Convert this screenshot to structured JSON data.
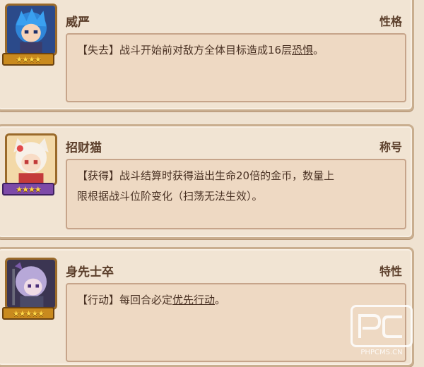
{
  "cards": [
    {
      "name": "威严",
      "kind": "性格",
      "rarity": "★★★★",
      "rarity_color": "#c98a1e",
      "portrait": "blue-haired-hero-portrait",
      "desc_prefix": "【失去】战斗开始前对敌方全体目标造成16层",
      "desc_keyword": "恐惧",
      "desc_suffix": "。"
    },
    {
      "name": "招财猫",
      "kind": "称号",
      "rarity": "★★★★",
      "rarity_color": "#7d4aa8",
      "portrait": "cat-eared-girl-portrait",
      "desc_line1": "【获得】战斗结算时获得溢出生命20倍的金币，数量上",
      "desc_line2": "限根据战斗位阶变化（扫荡无法生效）。"
    },
    {
      "name": "身先士卒",
      "kind": "特性",
      "rarity": "★★★★★",
      "rarity_color": "#c98a1e",
      "portrait": "silver-haired-warrior-portrait",
      "desc_prefix": "【行动】每回合必定",
      "desc_keyword": "优先行动",
      "desc_suffix": "。"
    }
  ],
  "watermark": {
    "text": "PHPCMS.CN"
  }
}
